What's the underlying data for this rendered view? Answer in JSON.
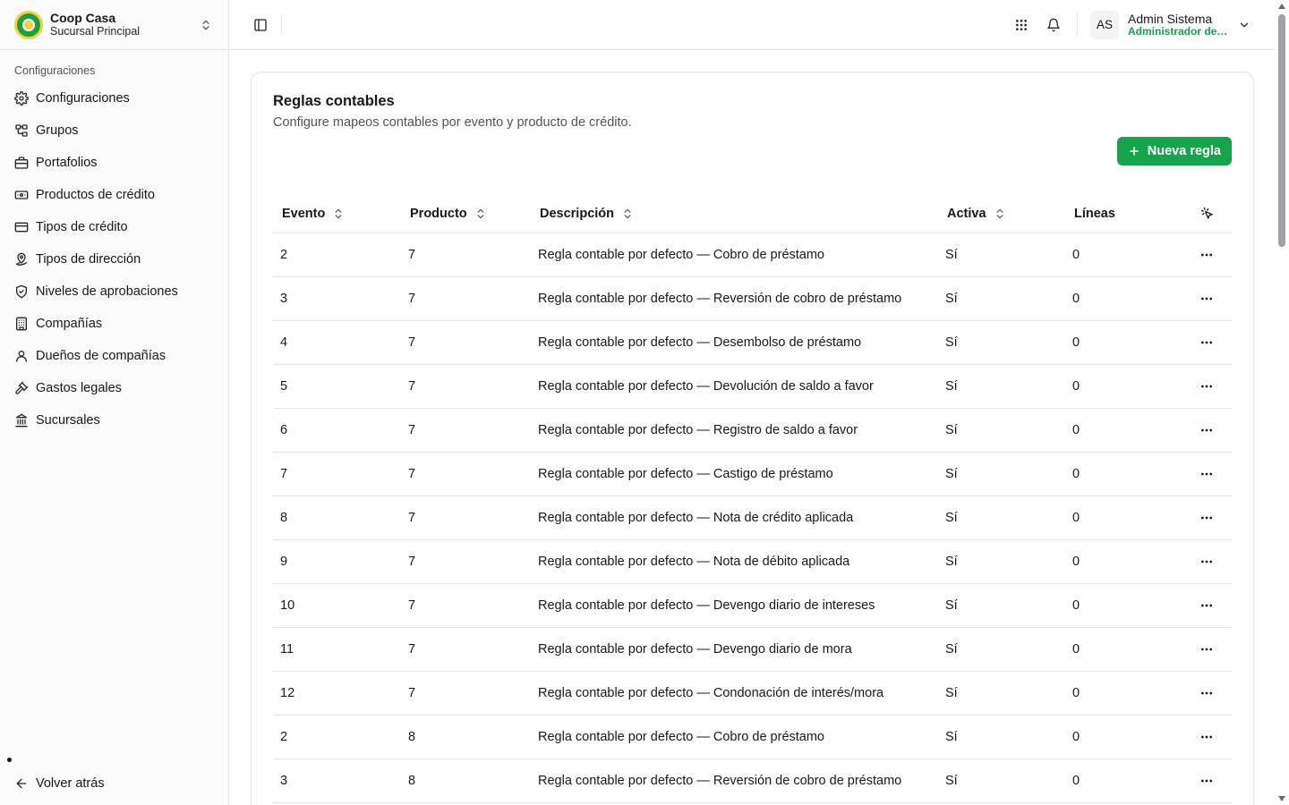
{
  "brand": {
    "name": "Coop Casa",
    "branch": "Sucursal Principal"
  },
  "sidebar": {
    "group_label": "Configuraciones",
    "items": [
      {
        "label": "Configuraciones",
        "icon": "gear-icon"
      },
      {
        "label": "Grupos",
        "icon": "network-icon"
      },
      {
        "label": "Portafolios",
        "icon": "briefcase-icon"
      },
      {
        "label": "Productos de crédito",
        "icon": "credit-product-icon"
      },
      {
        "label": "Tipos de crédito",
        "icon": "credit-card-icon"
      },
      {
        "label": "Tipos de dirección",
        "icon": "map-pin-icon"
      },
      {
        "label": "Niveles de aprobaciones",
        "icon": "shield-check-icon"
      },
      {
        "label": "Compañías",
        "icon": "building-icon"
      },
      {
        "label": "Dueños de compañías",
        "icon": "user-icon"
      },
      {
        "label": "Gastos legales",
        "icon": "gavel-icon"
      },
      {
        "label": "Sucursales",
        "icon": "bank-icon"
      }
    ],
    "back_label": "Volver atrás"
  },
  "user": {
    "initials": "AS",
    "name": "Admin Sistema",
    "role": "Administrador del sistema"
  },
  "page": {
    "title": "Reglas contables",
    "subtitle": "Configure mapeos contables por evento y producto de crédito.",
    "new_button": "Nueva regla"
  },
  "table": {
    "columns": [
      "Evento",
      "Producto",
      "Descripción",
      "Activa",
      "Líneas"
    ],
    "rows": [
      {
        "evento": "2",
        "producto": "7",
        "descripcion": "Regla contable por defecto — Cobro de préstamo",
        "activa": "Sí",
        "lineas": "0"
      },
      {
        "evento": "3",
        "producto": "7",
        "descripcion": "Regla contable por defecto — Reversión de cobro de préstamo",
        "activa": "Sí",
        "lineas": "0"
      },
      {
        "evento": "4",
        "producto": "7",
        "descripcion": "Regla contable por defecto — Desembolso de préstamo",
        "activa": "Sí",
        "lineas": "0"
      },
      {
        "evento": "5",
        "producto": "7",
        "descripcion": "Regla contable por defecto — Devolución de saldo a favor",
        "activa": "Sí",
        "lineas": "0"
      },
      {
        "evento": "6",
        "producto": "7",
        "descripcion": "Regla contable por defecto — Registro de saldo a favor",
        "activa": "Sí",
        "lineas": "0"
      },
      {
        "evento": "7",
        "producto": "7",
        "descripcion": "Regla contable por defecto — Castigo de préstamo",
        "activa": "Sí",
        "lineas": "0"
      },
      {
        "evento": "8",
        "producto": "7",
        "descripcion": "Regla contable por defecto — Nota de crédito aplicada",
        "activa": "Sí",
        "lineas": "0"
      },
      {
        "evento": "9",
        "producto": "7",
        "descripcion": "Regla contable por defecto — Nota de débito aplicada",
        "activa": "Sí",
        "lineas": "0"
      },
      {
        "evento": "10",
        "producto": "7",
        "descripcion": "Regla contable por defecto — Devengo diario de intereses",
        "activa": "Sí",
        "lineas": "0"
      },
      {
        "evento": "11",
        "producto": "7",
        "descripcion": "Regla contable por defecto — Devengo diario de mora",
        "activa": "Sí",
        "lineas": "0"
      },
      {
        "evento": "12",
        "producto": "7",
        "descripcion": "Regla contable por defecto — Condonación de interés/mora",
        "activa": "Sí",
        "lineas": "0"
      },
      {
        "evento": "2",
        "producto": "8",
        "descripcion": "Regla contable por defecto — Cobro de préstamo",
        "activa": "Sí",
        "lineas": "0"
      },
      {
        "evento": "3",
        "producto": "8",
        "descripcion": "Regla contable por defecto — Reversión de cobro de préstamo",
        "activa": "Sí",
        "lineas": "0"
      }
    ]
  },
  "colors": {
    "accent": "#16a34a",
    "border": "#e4e4e7",
    "sidebar_bg": "#fafafa"
  }
}
